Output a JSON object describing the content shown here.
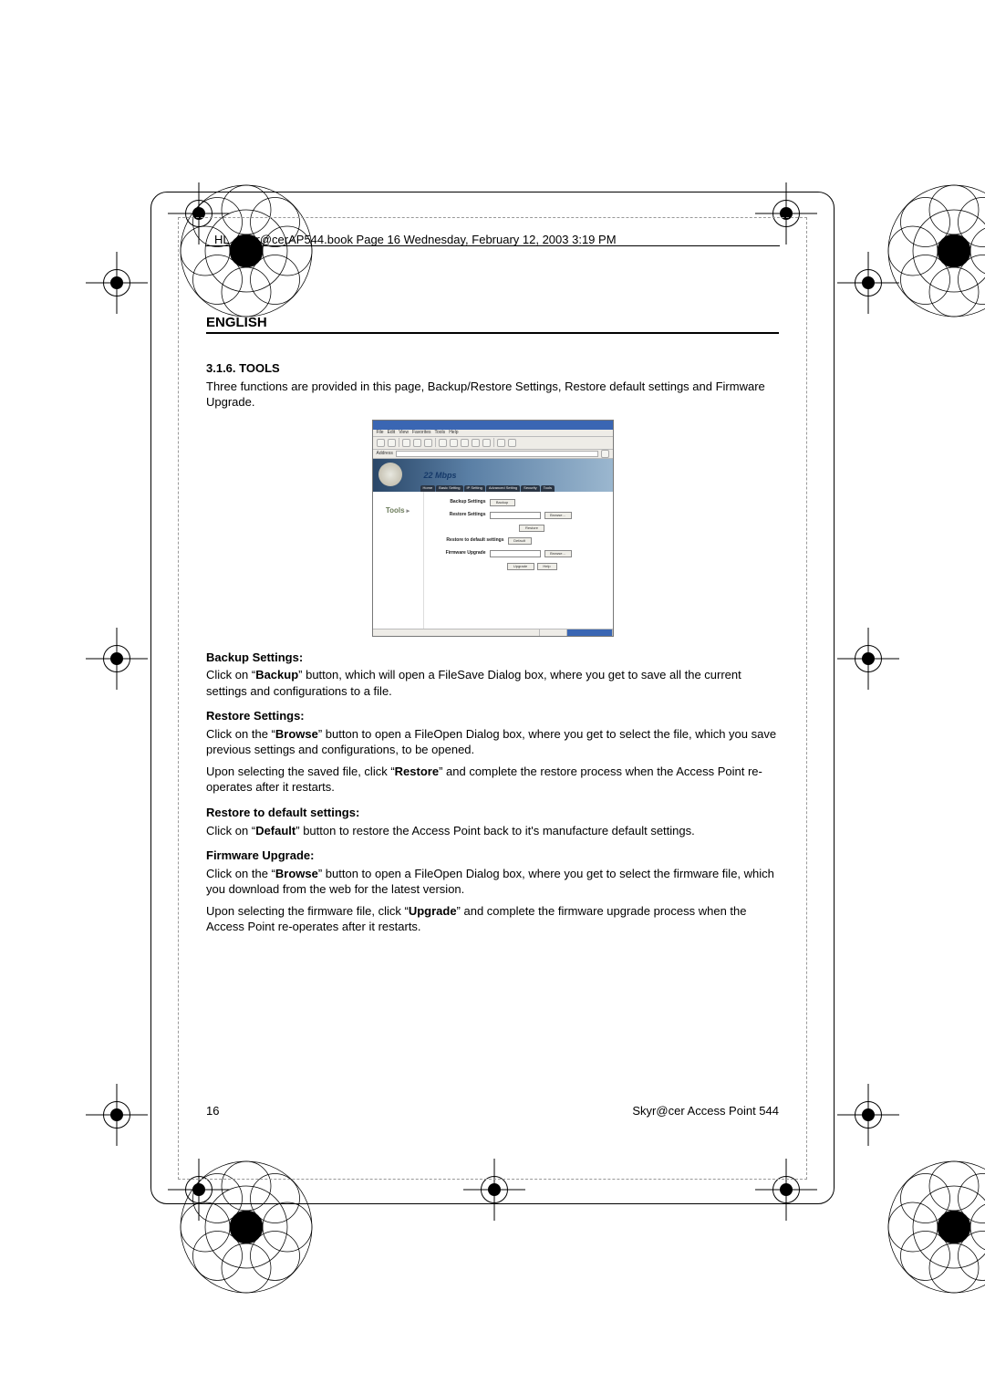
{
  "header": "HL_Skyr@cerAP544.book  Page 16  Wednesday, February 12, 2003  3:19 PM",
  "language": "ENGLISH",
  "section_title": "3.1.6. TOOLS",
  "intro": "Three functions are provided in this page, Backup/Restore Settings, Restore default settings and Firmware Upgrade.",
  "screenshot": {
    "menu": [
      "File",
      "Edit",
      "View",
      "Favorites",
      "Tools",
      "Help"
    ],
    "brand": "22 Mbps",
    "tabs": [
      "Home",
      "Basic Setting",
      "IP Setting",
      "Advanced Setting",
      "Security",
      "Tools"
    ],
    "side_label": "Tools",
    "rows": {
      "backup_label": "Backup Settings",
      "backup_btn": "Backup",
      "restore_label": "Restore Settings",
      "browse1": "Browse...",
      "restore_btn": "Restore",
      "default_label": "Restore to default settings",
      "default_btn": "Default",
      "fw_label": "Firmware Upgrade",
      "browse2": "Browse...",
      "upgrade_btn": "Upgrade",
      "help_btn": "Help"
    }
  },
  "sections": {
    "backup_h": "Backup Settings:",
    "backup_p_1": "Click on “",
    "backup_bold": "Backup",
    "backup_p_2": "” button, which will open a FileSave Dialog box, where you get to save all the current settings and configurations to a file.",
    "restore_h": "Restore Settings:",
    "restore_p1_1": "Click on the “",
    "restore_p1_b": "Browse",
    "restore_p1_2": "” button to open a FileOpen Dialog box, where you get to select the file, which you save previous settings and configurations, to be opened.",
    "restore_p2_1": "Upon selecting the saved file, click “",
    "restore_p2_b": "Restore",
    "restore_p2_2": "” and complete the restore process when the Access Point re-operates after it restarts.",
    "default_h": "Restore to default settings:",
    "default_p_1": "Click on “",
    "default_p_b": "Default",
    "default_p_2": "” button to restore the Access Point back to it's manufacture default settings.",
    "fw_h": "Firmware Upgrade:",
    "fw_p1_1": "Click on the “",
    "fw_p1_b": "Browse",
    "fw_p1_2": "” button to open a FileOpen Dialog box, where you get to select the firmware file, which you download from the web for the latest version.",
    "fw_p2_1": "Upon selecting the firmware file, click “",
    "fw_p2_b": "Upgrade",
    "fw_p2_2": "” and complete the firmware upgrade process when the Access Point re-operates after it restarts."
  },
  "footer": {
    "page_no": "16",
    "product": "Skyr@cer Access Point 544"
  }
}
